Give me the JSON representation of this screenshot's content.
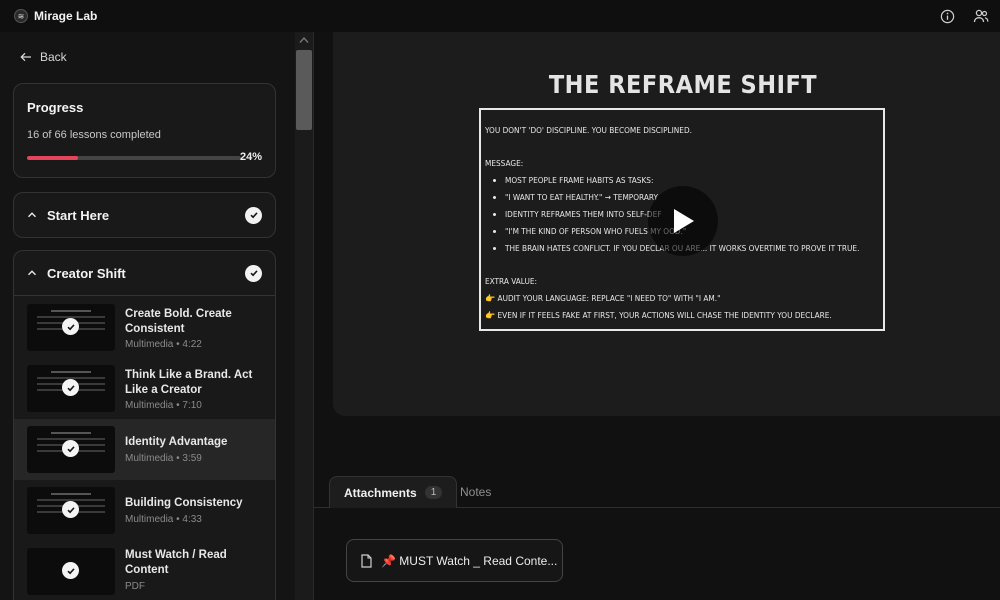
{
  "app": {
    "title": "Mirage Lab"
  },
  "sidebar": {
    "back_label": "Back",
    "progress": {
      "title": "Progress",
      "summary": "16 of 66 lessons completed",
      "percent_label": "24%",
      "percent": 24
    },
    "sections": [
      {
        "title": "Start Here",
        "completed": true
      },
      {
        "title": "Creator Shift",
        "completed": true,
        "lessons": [
          {
            "title": "Create Bold. Create Consistent",
            "meta": "Multimedia • 4:22",
            "completed": true
          },
          {
            "title": "Think Like a Brand. Act Like a Creator",
            "meta": "Multimedia • 7:10",
            "completed": true
          },
          {
            "title": "Identity Advantage",
            "meta": "Multimedia • 3:59",
            "completed": true,
            "active": true
          },
          {
            "title": "Building Consistency",
            "meta": "Multimedia • 4:33",
            "completed": true
          },
          {
            "title": "Must Watch / Read Content",
            "meta": "PDF",
            "completed": true
          }
        ]
      }
    ]
  },
  "video": {
    "title": "THE REFRAME SHIFT",
    "intro": "You don't 'do' discipline. You become disciplined.",
    "message_label": "Message:",
    "bullets": [
      "Most people frame habits as tasks:",
      "\"I want to eat healthy.\" → temporary",
      "Identity reframes them into self-def",
      "\"I'm the kind of person who fuels my          ood.\"",
      "The brain hates conflict. If you declar          ou are... it works overtime to prove it true."
    ],
    "extra_label": "Extra value:",
    "extras": [
      "👉 Audit your language: replace \"I need to\" with \"I am.\"",
      "👉 Even if it feels fake at first, your actions will chase the identity you declare."
    ]
  },
  "tabs": [
    {
      "label": "Attachments",
      "count": "1",
      "active": true
    },
    {
      "label": "Notes",
      "active": false
    }
  ],
  "attachments": [
    {
      "label": "📌 MUST Watch _ Read Conte...",
      "icon": "file-icon"
    }
  ],
  "colors": {
    "accent": "#e4455b",
    "background": "#111111"
  }
}
